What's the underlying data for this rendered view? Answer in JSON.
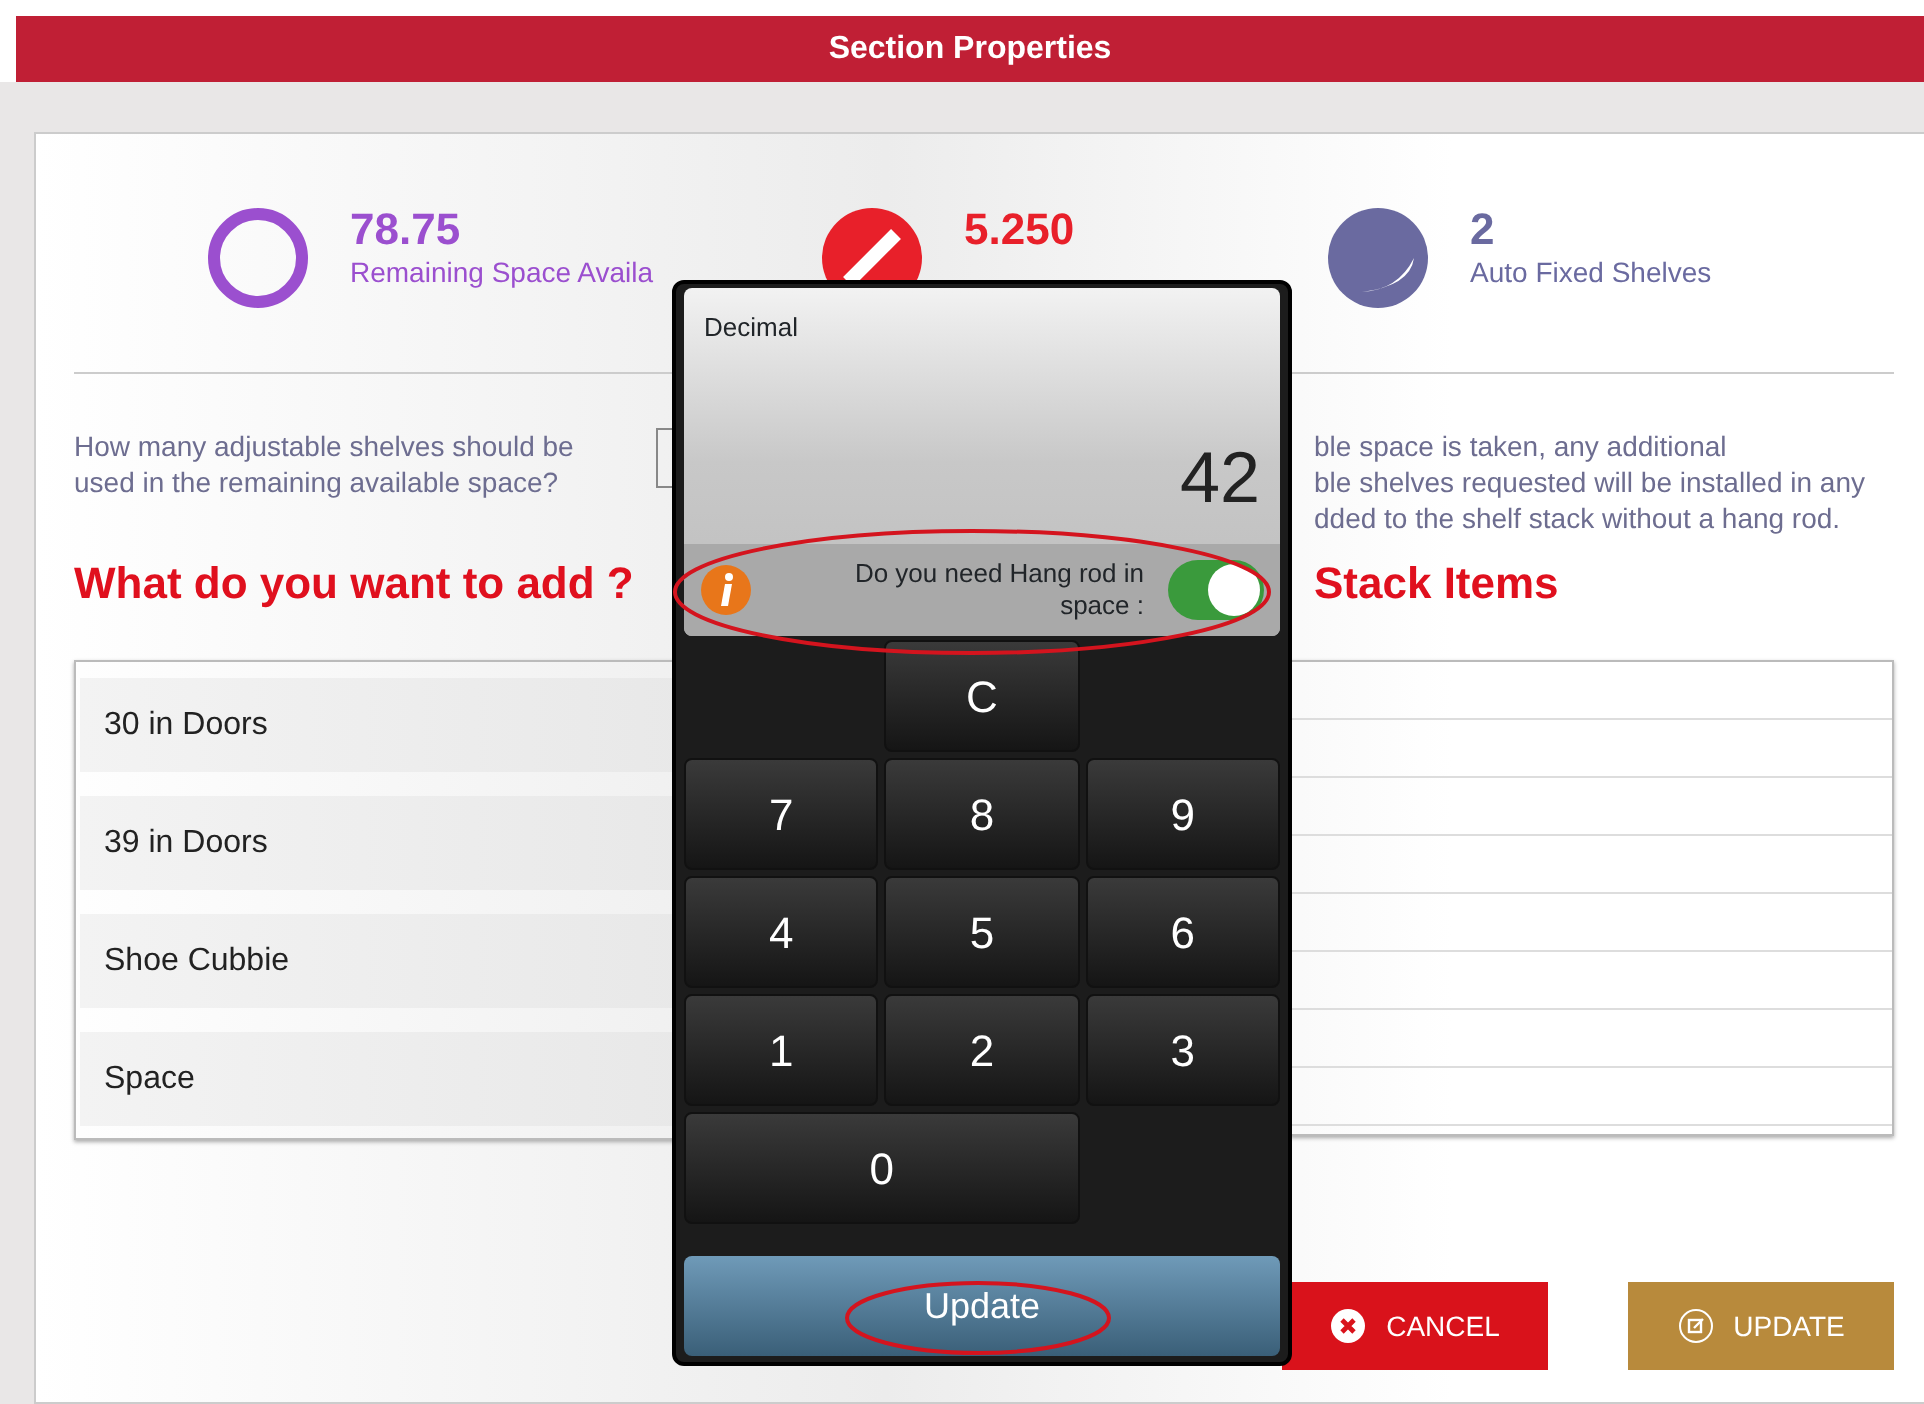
{
  "header": {
    "title": "Section Properties"
  },
  "stats": [
    {
      "kind": "ring",
      "value": "78.75",
      "label": "Remaining Space Availa",
      "color": "#9b4fcf"
    },
    {
      "kind": "slash",
      "value": "5.250",
      "color": "#e8202a"
    },
    {
      "kind": "crescent",
      "value": "2",
      "label": "Auto Fixed Shelves",
      "color": "#6a6aa0"
    }
  ],
  "question": "How many adjustable shelves should be used in the remaining available space?",
  "note_lines": [
    "ble space is taken, any additional",
    "ble shelves requested will be installed in any",
    "dded to the shelf stack without a hang rod."
  ],
  "add_heading": "What do you want to add ?",
  "add_items": [
    {
      "label": "30 in Doors"
    },
    {
      "label": "39 in Doors"
    },
    {
      "label": "Shoe Cubbie"
    },
    {
      "label": "Space"
    }
  ],
  "stack_heading": "Stack Items",
  "buttons": [
    {
      "kind": "cancel",
      "label": "CANCEL"
    },
    {
      "kind": "update",
      "label": "UPDATE"
    }
  ],
  "keypad": {
    "mode": "Decimal",
    "value": "42",
    "hang_rod": {
      "label": "Do you need Hang rod in space :",
      "on": true,
      "highlighted": true
    },
    "keys": [
      {
        "label": "C",
        "kind": "clear"
      },
      {
        "label": "7",
        "kind": "digit"
      },
      {
        "label": "8",
        "kind": "digit"
      },
      {
        "label": "9",
        "kind": "digit"
      },
      {
        "label": "4",
        "kind": "digit"
      },
      {
        "label": "5",
        "kind": "digit"
      },
      {
        "label": "6",
        "kind": "digit"
      },
      {
        "label": "1",
        "kind": "digit"
      },
      {
        "label": "2",
        "kind": "digit"
      },
      {
        "label": "3",
        "kind": "digit"
      },
      {
        "label": "0",
        "kind": "zero"
      }
    ],
    "submit": {
      "label": "Update",
      "highlighted": true
    }
  }
}
